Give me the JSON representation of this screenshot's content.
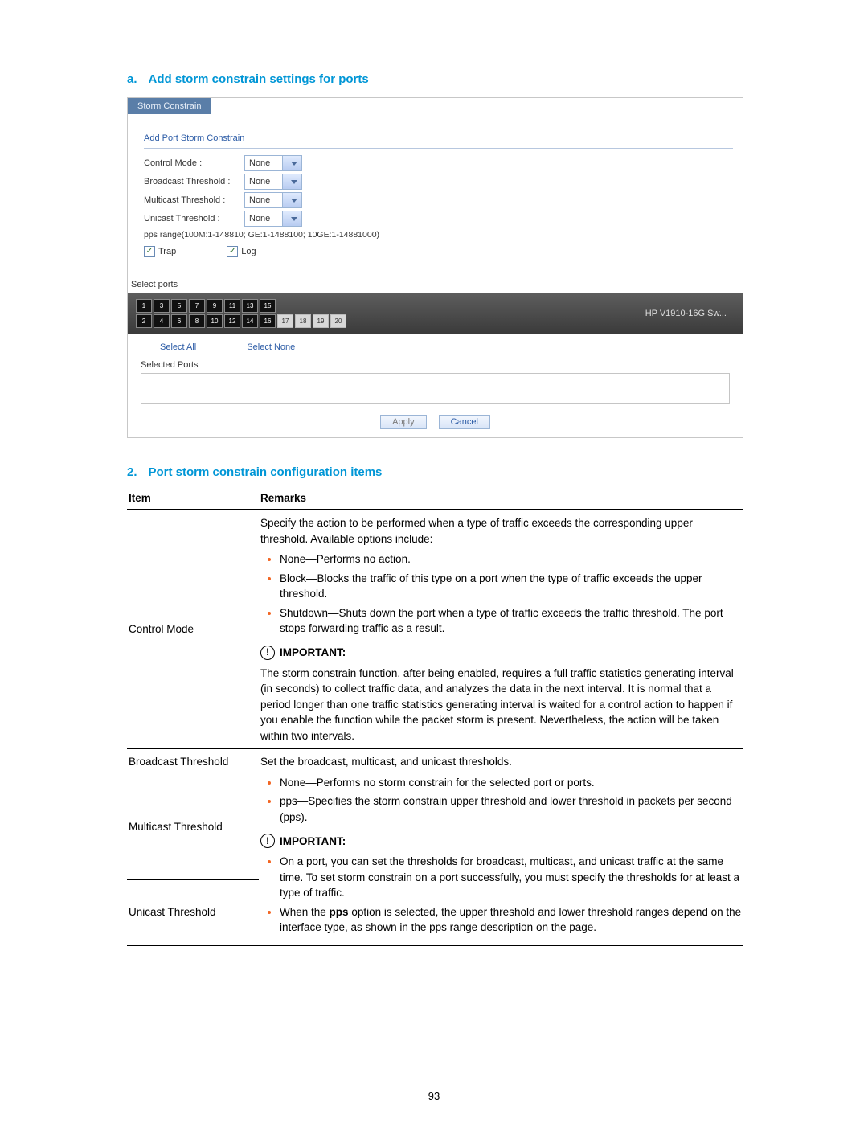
{
  "headings": {
    "a_prefix": "a.",
    "a_text": "Add storm constrain settings for ports",
    "two_prefix": "2.",
    "two_text": "Port storm constrain configuration items"
  },
  "shot": {
    "tab": "Storm Constrain",
    "section_title": "Add Port Storm Constrain",
    "rows": {
      "control_label": "Control Mode :",
      "control_value": "None",
      "broadcast_label": "Broadcast Threshold :",
      "broadcast_value": "None",
      "multicast_label": "Multicast Threshold :",
      "multicast_value": "None",
      "unicast_label": "Unicast Threshold :",
      "unicast_value": "None"
    },
    "pps_range": "pps range(100M:1-148810; GE:1-1488100; 10GE:1-14881000)",
    "trap_label": "Trap",
    "log_label": "Log",
    "select_ports_label": "Select ports",
    "ports_top": [
      "1",
      "3",
      "5",
      "7",
      "9",
      "11",
      "13",
      "15"
    ],
    "ports_bottom_dark": [
      "2",
      "4",
      "6",
      "8",
      "10",
      "12",
      "14",
      "16"
    ],
    "ports_bottom_light": [
      "17",
      "18",
      "19",
      "20"
    ],
    "device_name": "HP V1910-16G Sw...",
    "select_all": "Select All",
    "select_none": "Select None",
    "selected_ports_label": "Selected Ports",
    "apply": "Apply",
    "cancel": "Cancel"
  },
  "table": {
    "headers": {
      "item": "Item",
      "remarks": "Remarks"
    },
    "row1": {
      "item": "Control Mode",
      "intro": "Specify the action to be performed when a type of traffic exceeds the corresponding upper threshold. Available options include:",
      "b1": "None—Performs no action.",
      "b2": "Block—Blocks the traffic of this type on a port when the type of traffic exceeds the upper threshold.",
      "b3": "Shutdown—Shuts down the port when a type of traffic exceeds the traffic threshold. The port stops forwarding traffic as a result.",
      "important_label": "IMPORTANT:",
      "important_text": "The storm constrain function, after being enabled, requires a full traffic statistics generating interval (in seconds) to collect traffic data, and analyzes the data in the next interval. It is normal that a period longer than one traffic statistics generating interval is waited for a control action to happen if you enable the function while the packet storm is present. Nevertheless, the action will be taken within two intervals."
    },
    "row2": {
      "item": "Broadcast Threshold"
    },
    "row3": {
      "item": "Multicast Threshold"
    },
    "row4": {
      "item": "Unicast Threshold",
      "intro": "Set the broadcast, multicast, and unicast thresholds.",
      "b1": "None—Performs no storm constrain for the selected port or ports.",
      "b2": "pps—Specifies the storm constrain upper threshold and lower threshold in packets per second (pps).",
      "important_label": "IMPORTANT:",
      "b3": "On a port, you can set the thresholds for broadcast, multicast, and unicast traffic at the same time. To set storm constrain on a port successfully, you must specify the thresholds for at least a type of traffic.",
      "b4_pre": "When the ",
      "b4_bold": "pps",
      "b4_post": " option is selected, the upper threshold and lower threshold ranges depend on the interface type, as shown in the pps range description on the page."
    }
  },
  "page_number": "93"
}
